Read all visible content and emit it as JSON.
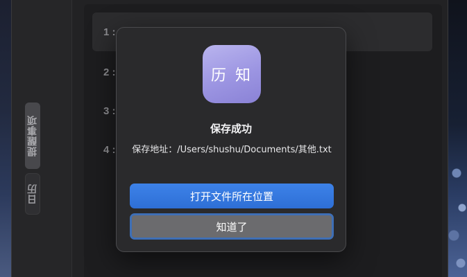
{
  "sidebar": {
    "tabs": [
      {
        "label": "提醒事项",
        "active": true
      },
      {
        "label": "日历",
        "active": false
      }
    ]
  },
  "list": {
    "rows": [
      {
        "label": "1 :",
        "active": true
      },
      {
        "label": "2 :",
        "active": false
      },
      {
        "label": "3 :",
        "active": false
      },
      {
        "label": "4 :",
        "active": false
      }
    ]
  },
  "dialog": {
    "app_icon_text": "历 知",
    "title": "保存成功",
    "message": "保存地址：/Users/shushu/Documents/其他.txt",
    "primary_button": "打开文件所在位置",
    "secondary_button": "知道了"
  },
  "colors": {
    "accent": "#3478f6",
    "icon_gradient_start": "#b9b4ee",
    "icon_gradient_end": "#8a82d6",
    "dialog_background": "#2a2a2c"
  }
}
